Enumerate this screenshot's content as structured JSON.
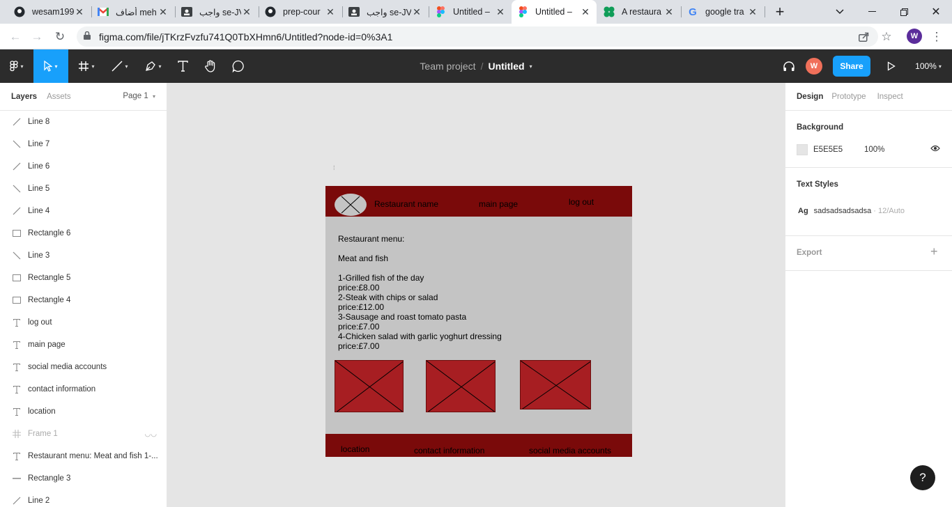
{
  "browser": {
    "tabs": [
      {
        "title": "wesam199",
        "icon": "github-icon"
      },
      {
        "title": "أضاف meh",
        "icon": "gmail-icon"
      },
      {
        "title": "واجب se-JV",
        "icon": "classroom-icon"
      },
      {
        "title": "prep-cour",
        "icon": "github-icon"
      },
      {
        "title": "واجب se-JV",
        "icon": "classroom-icon"
      },
      {
        "title": "Untitled –",
        "icon": "figma-icon"
      },
      {
        "title": "Untitled –",
        "icon": "figma-icon"
      },
      {
        "title": "A restaura",
        "icon": "clover-icon"
      },
      {
        "title": "google tra",
        "icon": "google-icon"
      }
    ],
    "url": "figma.com/file/jTKrzFvzfu741Q0TbXHmn6/Untitled?node-id=0%3A1",
    "profile_initial": "W"
  },
  "toolbar": {
    "team": "Team project",
    "separator": "/",
    "file_name": "Untitled",
    "user_initial": "W",
    "share_label": "Share",
    "zoom": "100%"
  },
  "left_panel": {
    "tabs": [
      "Layers",
      "Assets"
    ],
    "page": "Page 1",
    "layers": [
      {
        "name": "Line 8",
        "type": "line-up"
      },
      {
        "name": "Line 7",
        "type": "line-down"
      },
      {
        "name": "Line 6",
        "type": "line-up"
      },
      {
        "name": "Line 5",
        "type": "line-down"
      },
      {
        "name": "Line 4",
        "type": "line-up"
      },
      {
        "name": "Rectangle 6",
        "type": "rect"
      },
      {
        "name": "Line 3",
        "type": "line-down"
      },
      {
        "name": "Rectangle 5",
        "type": "rect"
      },
      {
        "name": "Rectangle 4",
        "type": "rect"
      },
      {
        "name": "log out",
        "type": "text"
      },
      {
        "name": "main page",
        "type": "text"
      },
      {
        "name": "social media accounts",
        "type": "text"
      },
      {
        "name": "contact information",
        "type": "text"
      },
      {
        "name": "location",
        "type": "text"
      },
      {
        "name": "Frame 1",
        "type": "frame"
      },
      {
        "name": "Restaurant menu: Meat and fish 1-...",
        "type": "text"
      },
      {
        "name": "Rectangle 3",
        "type": "hline"
      },
      {
        "name": "Line 2",
        "type": "line-up"
      }
    ]
  },
  "canvas": {
    "header_links": [
      "Restaurant name",
      "main page",
      "log out"
    ],
    "menu_lines": [
      "Restaurant menu:",
      "",
      "Meat and fish",
      "",
      "1-Grilled fish of the day",
      "price:£8.00",
      "2-Steak with chips or salad",
      "price:£12.00",
      "3-Sausage and roast tomato pasta",
      "price:£7.00",
      "4-Chicken salad with garlic yoghurt dressing",
      "price:£7.00"
    ],
    "footer_links": [
      "location",
      "contact information",
      "social media accounts"
    ]
  },
  "right_panel": {
    "tabs": [
      "Design",
      "Prototype",
      "Inspect"
    ],
    "background_title": "Background",
    "background_hex": "E5E5E5",
    "background_opacity": "100%",
    "text_styles_title": "Text Styles",
    "text_style_name": "sadsadsadsadsa",
    "text_style_meta": "· 12/Auto",
    "export_title": "Export",
    "help_label": "?"
  }
}
